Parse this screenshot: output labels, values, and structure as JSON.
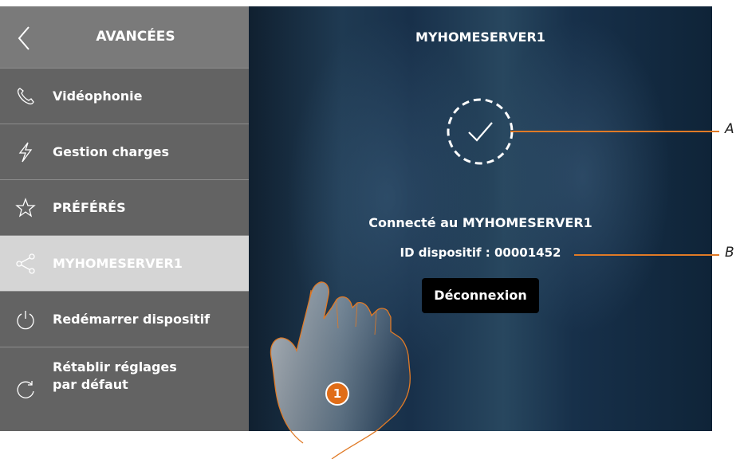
{
  "sidebar": {
    "title": "AVANCÉES",
    "items": [
      {
        "label": "Vidéophonie",
        "icon": "phone-icon"
      },
      {
        "label": "Gestion charges",
        "icon": "lightning-icon"
      },
      {
        "label": "PRÉFÉRÉS",
        "icon": "star-icon"
      },
      {
        "label": "MYHOMESERVER1",
        "icon": "share-icon",
        "active": true
      },
      {
        "label": "Redémarrer dispositif",
        "icon": "power-icon"
      },
      {
        "label": "Rétablir réglages\npar défaut",
        "icon": "reset-icon"
      }
    ]
  },
  "main": {
    "title": "MYHOMESERVER1",
    "status_icon": "check-circle-icon",
    "connected_text": "Connecté au MYHOMESERVER1",
    "device_id_text": "ID dispositif : 00001452",
    "disconnect_label": "Déconnexion"
  },
  "annotations": {
    "callout_a": "A",
    "callout_b": "B",
    "step_badge": "1"
  },
  "colors": {
    "sidebar_bg": "#636363",
    "sidebar_header_bg": "#7a7a7a",
    "active_item_bg": "#d5d5d5",
    "callout_line": "#e07a26",
    "step_badge": "#e06d18",
    "button_bg": "#000000"
  }
}
